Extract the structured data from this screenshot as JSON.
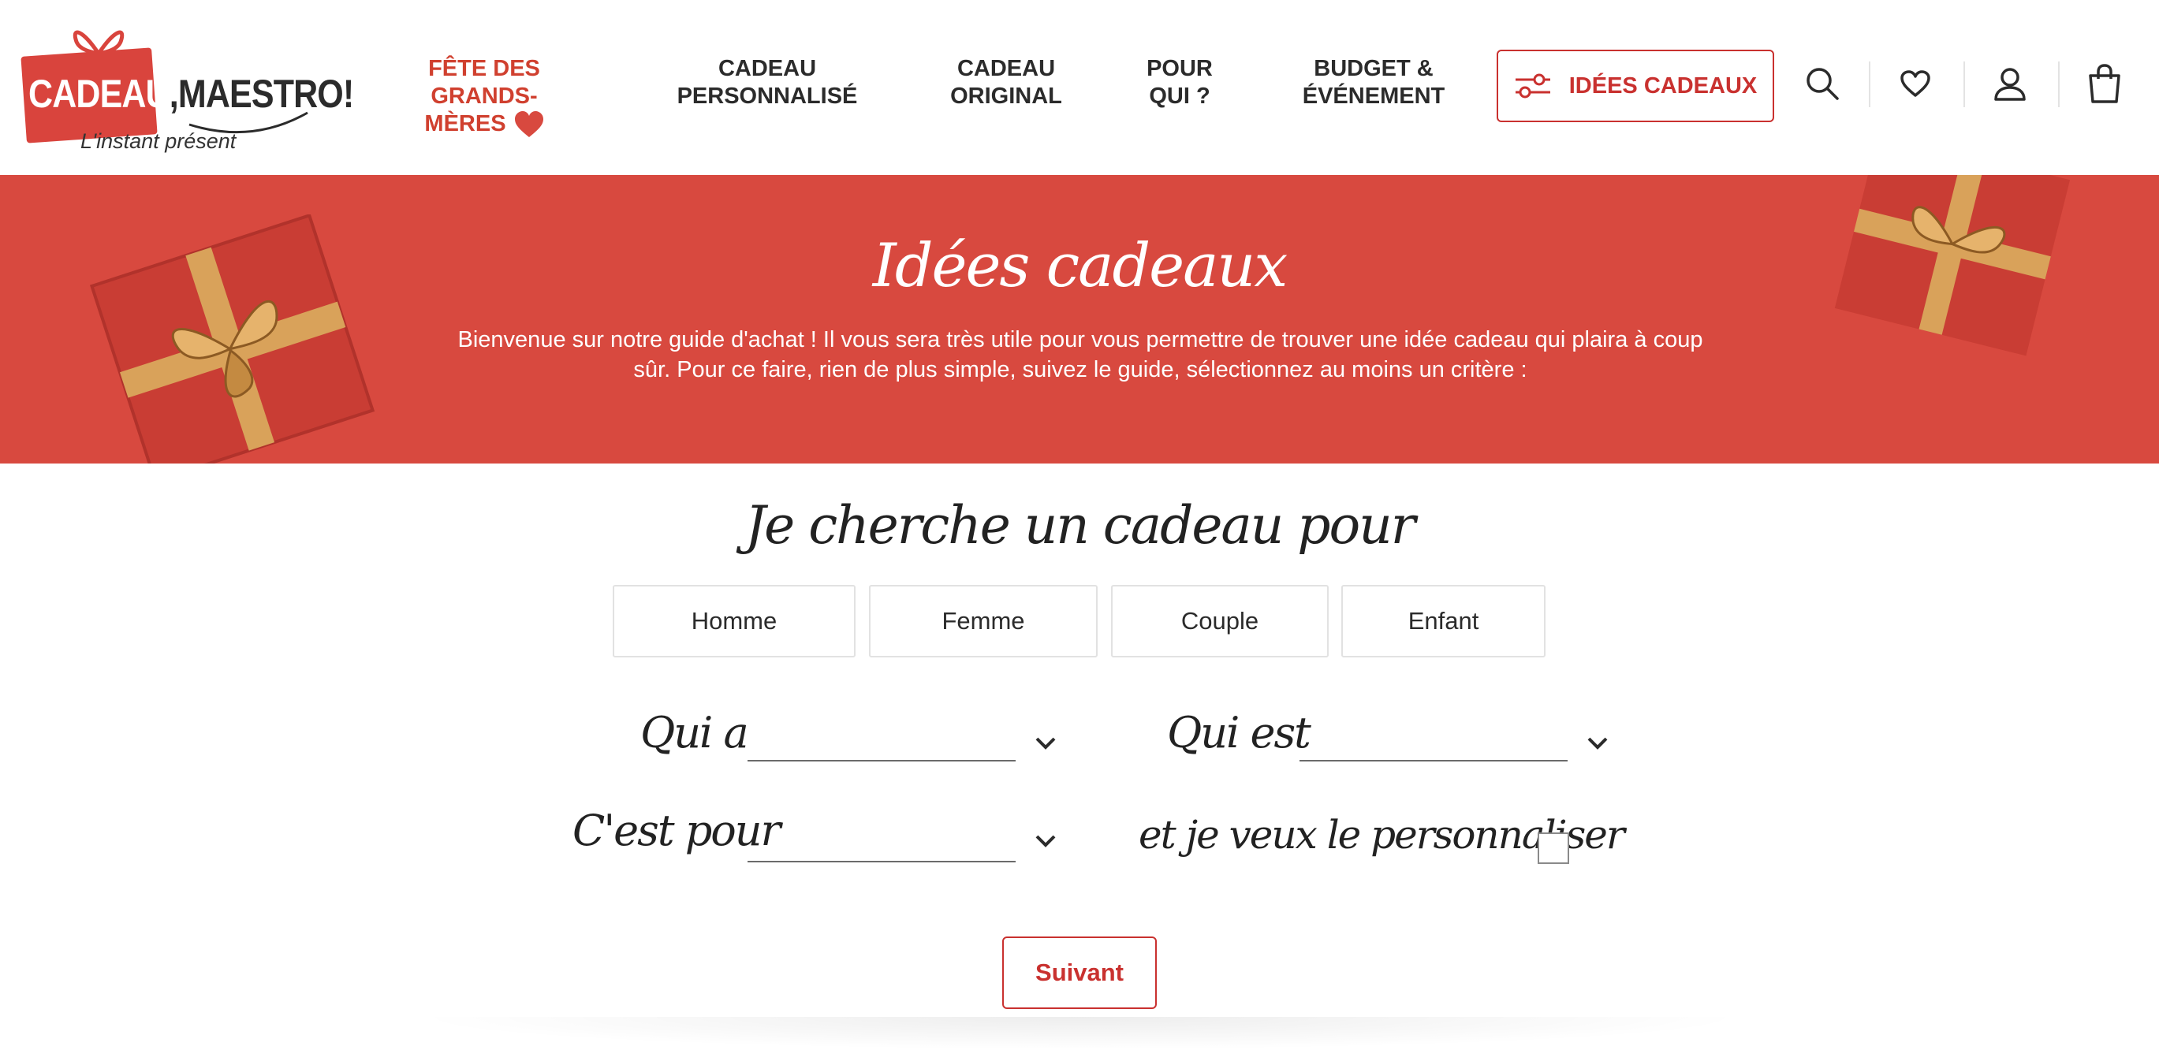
{
  "logo": {
    "word1": "CADEAU",
    "comma": ",",
    "word2": "MAESTRO!",
    "tagline": "L'instant présent"
  },
  "nav": {
    "items": [
      {
        "label_line1": "FÊTE DES GRANDS-",
        "label_line2": "MÈRES",
        "accent": true
      },
      {
        "label_line1": "CADEAU",
        "label_line2": "PERSONNALISÉ"
      },
      {
        "label_line1": "CADEAU",
        "label_line2": "ORIGINAL"
      },
      {
        "label_line1": "POUR",
        "label_line2": "QUI ?"
      },
      {
        "label_line1": "BUDGET &",
        "label_line2": "ÉVÉNEMENT"
      }
    ],
    "ideas_button": "IDÉES CADEAUX",
    "icons": [
      "search-icon",
      "heart-icon",
      "user-icon",
      "bag-icon"
    ]
  },
  "banner": {
    "title": "Idées cadeaux",
    "text": "Bienvenue sur notre guide d'achat ! Il vous sera très utile pour vous permettre de trouver une idée cadeau qui plaira à coup sûr. Pour ce faire, rien de plus simple, suivez le guide, sélectionnez au moins un critère :"
  },
  "form": {
    "title": "Je cherche un cadeau pour",
    "choices": [
      "Homme",
      "Femme",
      "Couple",
      "Enfant"
    ],
    "age_label": "Qui a",
    "age_value": "",
    "trait_label": "Qui est",
    "trait_value": "",
    "occasion_label": "C'est pour",
    "occasion_value": "",
    "personalize_label": "et je veux le personnaliser",
    "personalize_checked": false,
    "next_button": "Suivant"
  },
  "colors": {
    "brand_red": "#d8493f",
    "accent_text": "#c9312f",
    "text": "#2b2b2b"
  }
}
